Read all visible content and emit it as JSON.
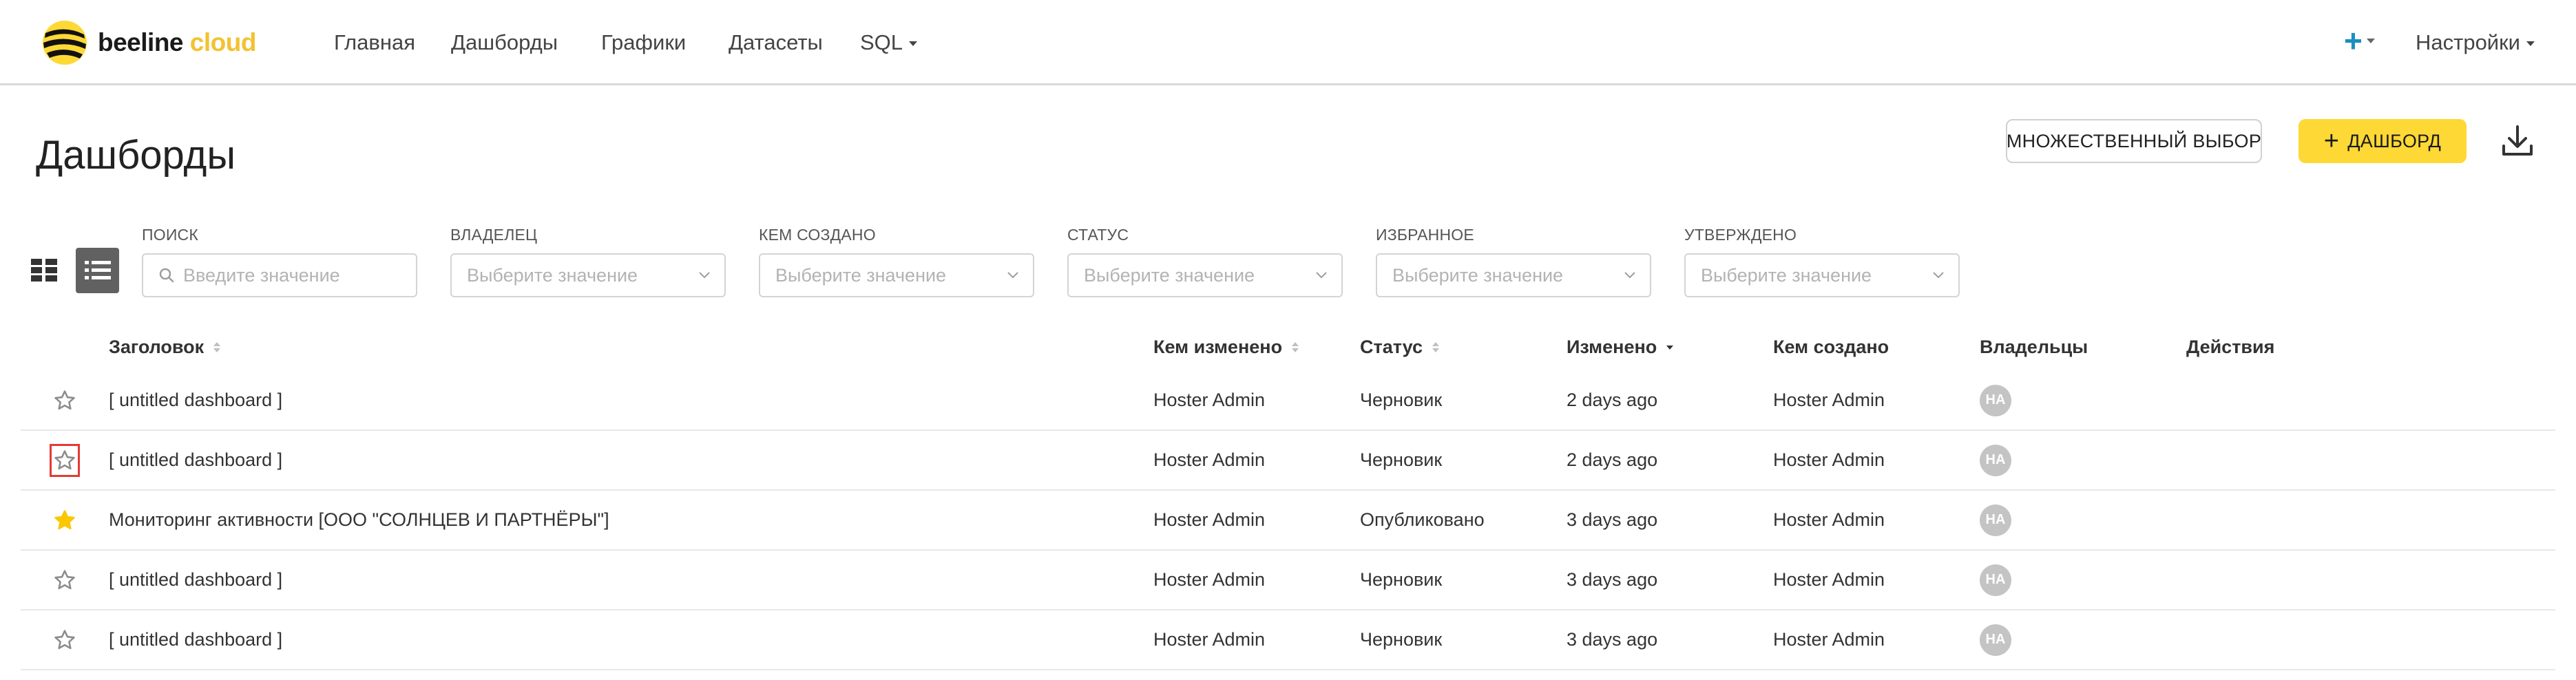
{
  "navbar": {
    "brand_main": "beeline",
    "brand_accent": "cloud",
    "items": [
      {
        "label": "Главная"
      },
      {
        "label": "Дашборды"
      },
      {
        "label": "Графики"
      },
      {
        "label": "Датасеты"
      },
      {
        "label": "SQL"
      }
    ],
    "plus_glyph": "+",
    "settings_label": "Настройки",
    "accent_color": "#fed835",
    "plus_color": "#1b8ec4"
  },
  "page": {
    "title": "Дашборды",
    "multi_select_label": "МНОЖЕСТВЕННЫЙ ВЫБОР",
    "add_dashboard_plus": "+",
    "add_dashboard_label": "ДАШБОРД",
    "download_icon": "download-icon"
  },
  "filters": {
    "search": {
      "label": "ПОИСК",
      "placeholder": "Введите значение"
    },
    "owner": {
      "label": "ВЛАДЕЛЕЦ",
      "placeholder": "Выберите значение"
    },
    "created_by": {
      "label": "КЕМ СОЗДАНО",
      "placeholder": "Выберите значение"
    },
    "status": {
      "label": "СТАТУС",
      "placeholder": "Выберите значение"
    },
    "favorite": {
      "label": "ИЗБРАННОЕ",
      "placeholder": "Выберите значение"
    },
    "certified": {
      "label": "УТВЕРЖДЕНО",
      "placeholder": "Выберите значение"
    }
  },
  "table": {
    "columns": {
      "title": "Заголовок",
      "modified_by": "Кем изменено",
      "status": "Статус",
      "modified": "Изменено",
      "created_by": "Кем создано",
      "owners": "Владельцы",
      "actions": "Действия"
    },
    "rows": [
      {
        "favorite": false,
        "title": "[ untitled dashboard ]",
        "modified_by": "Hoster Admin",
        "status": "Черновик",
        "modified": "2 days ago",
        "created_by": "Hoster Admin",
        "owner_initials": "HA"
      },
      {
        "favorite": false,
        "title": "[ untitled dashboard ]",
        "modified_by": "Hoster Admin",
        "status": "Черновик",
        "modified": "2 days ago",
        "created_by": "Hoster Admin",
        "owner_initials": "HA"
      },
      {
        "favorite": true,
        "title": "Мониторинг активности [ООО \"СОЛНЦЕВ И ПАРТНЁРЫ\"]",
        "modified_by": "Hoster Admin",
        "status": "Опубликовано",
        "modified": "3 days ago",
        "created_by": "Hoster Admin",
        "owner_initials": "HA"
      },
      {
        "favorite": false,
        "title": "[ untitled dashboard ]",
        "modified_by": "Hoster Admin",
        "status": "Черновик",
        "modified": "3 days ago",
        "created_by": "Hoster Admin",
        "owner_initials": "HA"
      },
      {
        "favorite": false,
        "title": "[ untitled dashboard ]",
        "modified_by": "Hoster Admin",
        "status": "Черновик",
        "modified": "3 days ago",
        "created_by": "Hoster Admin",
        "owner_initials": "HA"
      }
    ]
  },
  "colors": {
    "star_active": "#fbc700",
    "star_inactive": "#8c8c8c",
    "focus_outline": "#e53935",
    "avatar_bg": "#c4c4c4"
  }
}
